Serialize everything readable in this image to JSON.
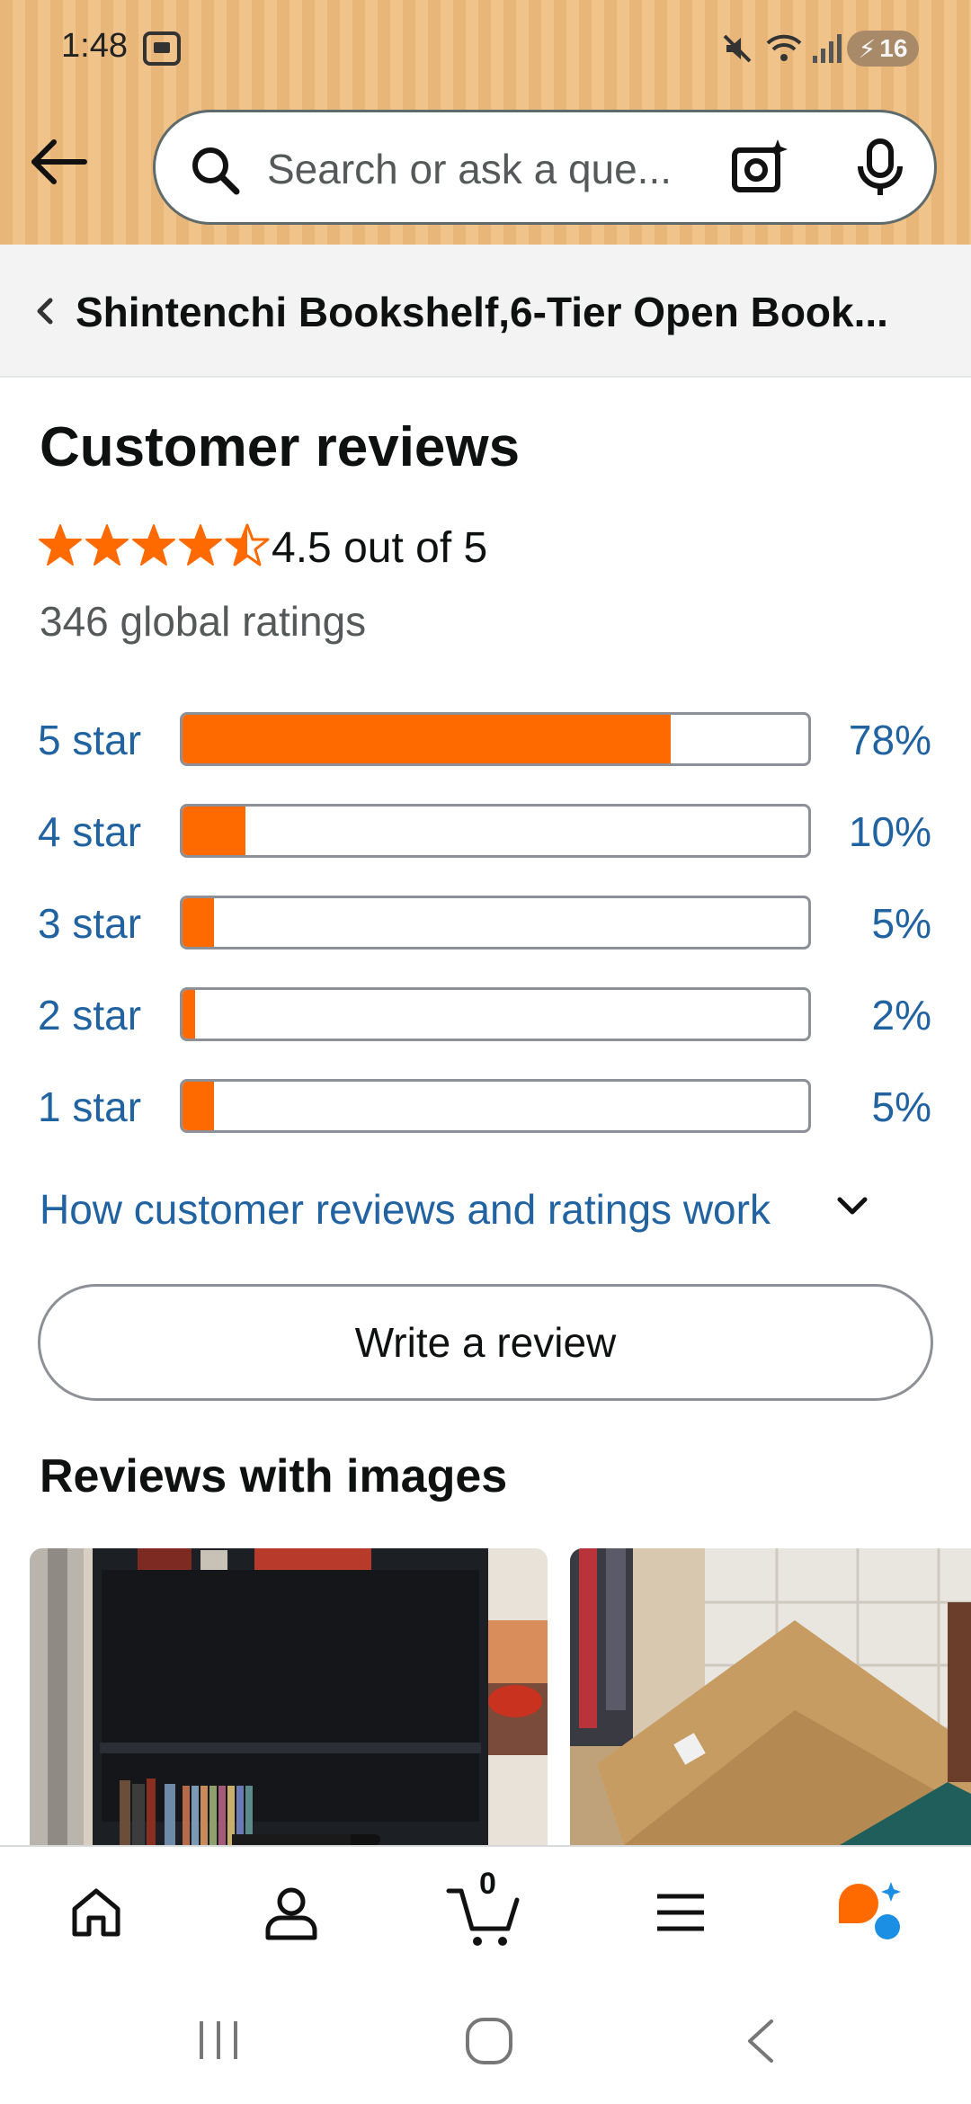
{
  "status_bar": {
    "time": "1:48",
    "battery": "16"
  },
  "search": {
    "placeholder": "Search or ask a que..."
  },
  "breadcrumb": {
    "title": "Shintenchi Bookshelf,6-Tier Open Book..."
  },
  "reviews": {
    "heading": "Customer reviews",
    "rating_value": 4.5,
    "rating_text": "4.5 out of 5",
    "global_ratings": "346 global ratings",
    "histogram": [
      {
        "label": "5 star",
        "percent": 78,
        "percent_text": "78%"
      },
      {
        "label": "4 star",
        "percent": 10,
        "percent_text": "10%"
      },
      {
        "label": "3 star",
        "percent": 5,
        "percent_text": "5%"
      },
      {
        "label": "2 star",
        "percent": 2,
        "percent_text": "2%"
      },
      {
        "label": "1 star",
        "percent": 5,
        "percent_text": "5%"
      }
    ],
    "how_link": "How customer reviews and ratings work",
    "write_review": "Write a review",
    "images_heading": "Reviews with images"
  },
  "bottom_nav": {
    "items": [
      "home-icon",
      "account-icon",
      "cart-icon",
      "menu-icon",
      "rufus-icon"
    ],
    "cart_count": "0"
  },
  "colors": {
    "accent": "#ff6a00",
    "link": "#2162a1",
    "header_bg": "#e8b678"
  }
}
